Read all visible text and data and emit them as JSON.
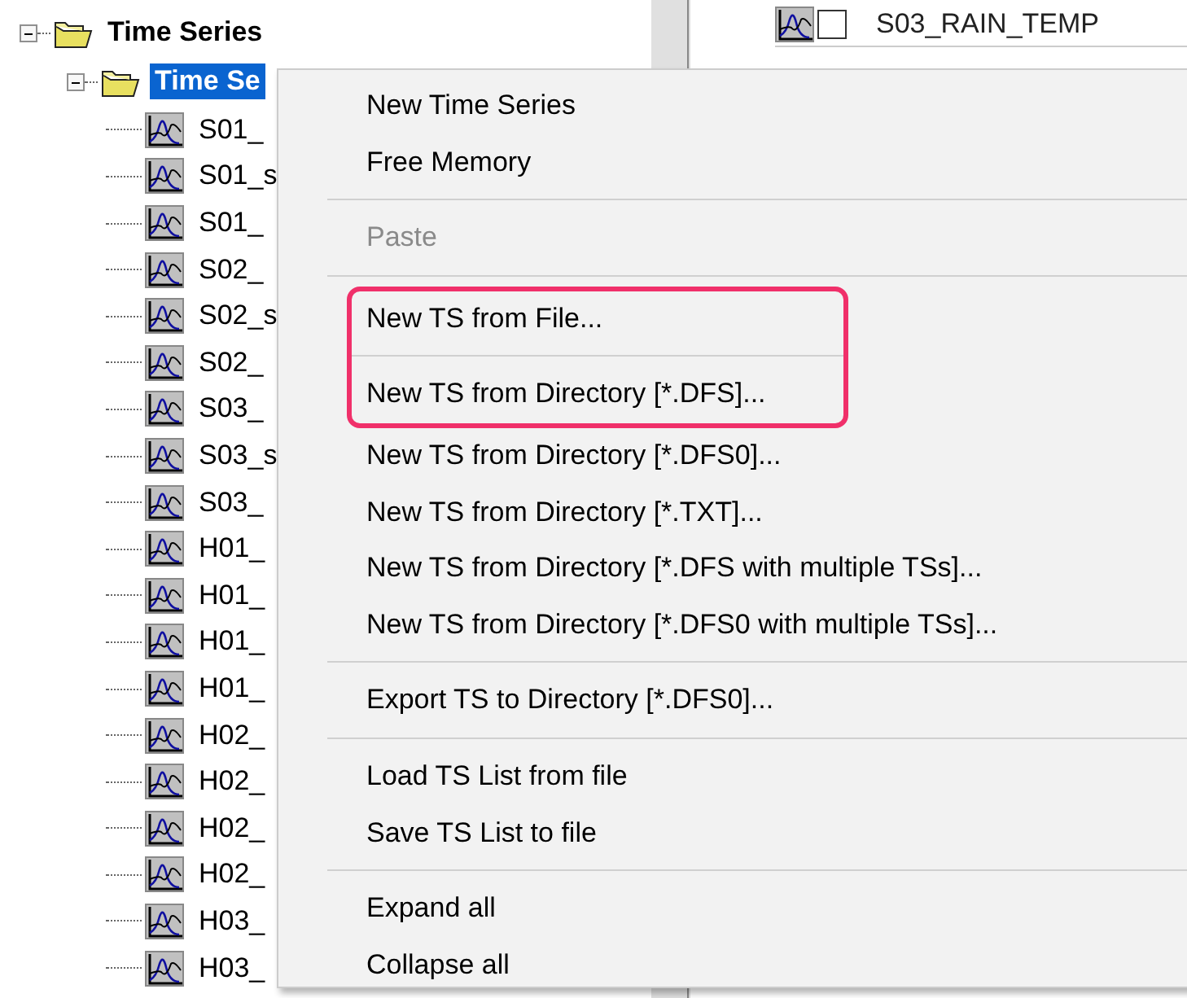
{
  "tree": [
    {
      "label": "Time Series",
      "kind": "folder",
      "expanded": true,
      "selected": false,
      "children": [
        {
          "label": "Time Se",
          "kind": "folder",
          "expanded": true,
          "selected": true,
          "children": [
            {
              "label": "S01_",
              "kind": "series",
              "selected": false
            },
            {
              "label": "S01_s",
              "kind": "series",
              "selected": false
            },
            {
              "label": "S01_",
              "kind": "series",
              "selected": false
            },
            {
              "label": "S02_",
              "kind": "series",
              "selected": false
            },
            {
              "label": "S02_s",
              "kind": "series",
              "selected": false
            },
            {
              "label": "S02_",
              "kind": "series",
              "selected": false
            },
            {
              "label": "S03_",
              "kind": "series",
              "selected": false
            },
            {
              "label": "S03_s",
              "kind": "series",
              "selected": false
            },
            {
              "label": "S03_",
              "kind": "series",
              "selected": false
            },
            {
              "label": "H01_",
              "kind": "series",
              "selected": false
            },
            {
              "label": "H01_",
              "kind": "series",
              "selected": false
            },
            {
              "label": "H01_",
              "kind": "series",
              "selected": false
            },
            {
              "label": "H01_",
              "kind": "series",
              "selected": false
            },
            {
              "label": "H02_",
              "kind": "series",
              "selected": false
            },
            {
              "label": "H02_",
              "kind": "series",
              "selected": false
            },
            {
              "label": "H02_",
              "kind": "series",
              "selected": false
            },
            {
              "label": "H02_",
              "kind": "series",
              "selected": false
            },
            {
              "label": "H03_",
              "kind": "series",
              "selected": false
            },
            {
              "label": "H03_",
              "kind": "series",
              "selected": false
            }
          ]
        }
      ]
    }
  ],
  "list": {
    "rows": [
      {
        "name": "S03_RAIN_TEMP",
        "checked": false
      }
    ]
  },
  "context_menu": {
    "items": [
      {
        "kind": "item",
        "label": "New Time Series",
        "disabled": false,
        "highlighted": false
      },
      {
        "kind": "item",
        "label": "Free Memory",
        "disabled": false,
        "highlighted": false
      },
      {
        "kind": "separator"
      },
      {
        "kind": "item",
        "label": "Paste",
        "disabled": true,
        "highlighted": false
      },
      {
        "kind": "separator"
      },
      {
        "kind": "item",
        "label": "New TS from File...",
        "disabled": false,
        "highlighted": true
      },
      {
        "kind": "separator"
      },
      {
        "kind": "item",
        "label": "New TS from Directory [*.DFS]...",
        "disabled": false,
        "highlighted": true
      },
      {
        "kind": "item",
        "label": "New TS from Directory [*.DFS0]...",
        "disabled": false,
        "highlighted": false
      },
      {
        "kind": "item",
        "label": "New TS from Directory [*.TXT]...",
        "disabled": false,
        "highlighted": false
      },
      {
        "kind": "item",
        "label": "New TS from Directory [*.DFS with multiple TSs]...",
        "disabled": false,
        "highlighted": false
      },
      {
        "kind": "item",
        "label": "New TS from Directory [*.DFS0 with multiple TSs]...",
        "disabled": false,
        "highlighted": false
      },
      {
        "kind": "separator"
      },
      {
        "kind": "item",
        "label": "Export TS to Directory [*.DFS0]...",
        "disabled": false,
        "highlighted": false
      },
      {
        "kind": "separator"
      },
      {
        "kind": "item",
        "label": "Load TS List from file",
        "disabled": false,
        "highlighted": false
      },
      {
        "kind": "item",
        "label": "Save TS List to file",
        "disabled": false,
        "highlighted": false
      },
      {
        "kind": "separator"
      },
      {
        "kind": "item",
        "label": "Expand all",
        "disabled": false,
        "highlighted": false
      },
      {
        "kind": "item",
        "label": "Collapse all",
        "disabled": false,
        "highlighted": false
      }
    ]
  }
}
